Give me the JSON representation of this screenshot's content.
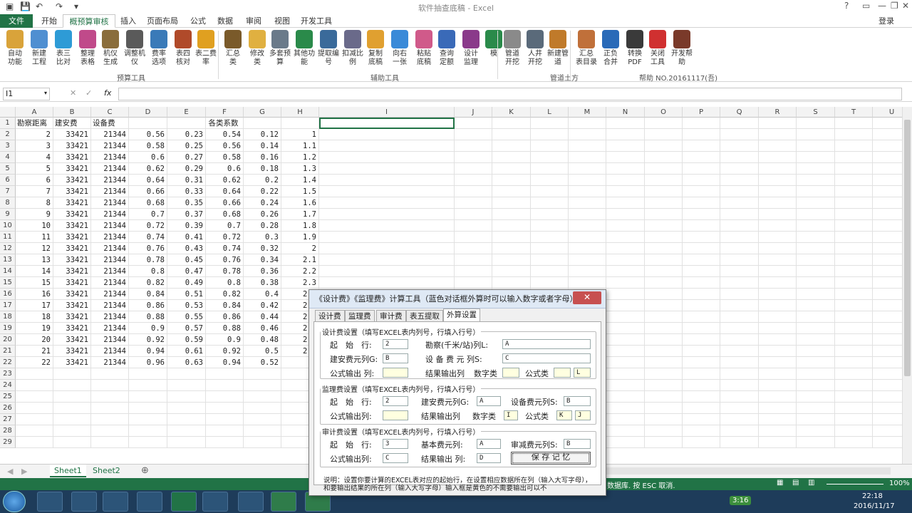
{
  "window": {
    "title": "软件抽查底稿 - Excel",
    "login": "登录"
  },
  "tabs": [
    "文件",
    "开始",
    "概预算审核",
    "插入",
    "页面布局",
    "公式",
    "数据",
    "审阅",
    "视图",
    "开发工具"
  ],
  "ribbon": {
    "buttons": [
      {
        "label": "自动\n功能",
        "icon": "auto-icon"
      },
      {
        "label": "新建\n工程",
        "icon": "new-project-icon"
      },
      {
        "label": "表三\n比对",
        "icon": "compare-icon"
      },
      {
        "label": "整理\n表格",
        "icon": "tidy-icon"
      },
      {
        "label": "机仪\n生成",
        "icon": "machine-icon"
      },
      {
        "label": "调整机\n仪",
        "icon": "adjust-icon"
      },
      {
        "label": "费率\n选项",
        "icon": "rate-icon"
      },
      {
        "label": "表四\n核对",
        "icon": "house-icon"
      },
      {
        "label": "表二费\n率",
        "icon": "pie-icon"
      },
      {
        "label": "汇总\n类",
        "icon": "people-icon"
      },
      {
        "label": "修改\n类",
        "icon": "pencil-icon"
      },
      {
        "label": "多套预\n算",
        "icon": "stack-icon"
      },
      {
        "label": "其他功\n能",
        "icon": "globe-icon"
      },
      {
        "label": "提取编\n号",
        "icon": "extract-icon"
      },
      {
        "label": "扣减比\n例",
        "icon": "deduct-icon"
      },
      {
        "label": "复制\n底稿",
        "icon": "copy-icon"
      },
      {
        "label": "向右\n一张",
        "icon": "arrow-right-icon"
      },
      {
        "label": "粘贴\n底稿",
        "icon": "paste-icon"
      },
      {
        "label": "查询\n定额",
        "icon": "query-icon"
      },
      {
        "label": "设计\n监理",
        "icon": "design-icon"
      },
      {
        "label": "模",
        "icon": "template-icon"
      },
      {
        "label": "管道\n开挖",
        "icon": "pipe-icon"
      },
      {
        "label": "人井\n开挖",
        "icon": "well-icon"
      },
      {
        "label": "新建管\n道",
        "icon": "new-pipe-icon"
      },
      {
        "label": "汇总\n表目录",
        "icon": "summary-icon"
      },
      {
        "label": "正负\n合并",
        "icon": "plus-minus-icon"
      },
      {
        "label": "转换\nPDF",
        "icon": "printer-icon"
      },
      {
        "label": "关闭\n工具",
        "icon": "close-tool-icon"
      },
      {
        "label": "开发帮\n助",
        "icon": "avatar-icon"
      }
    ],
    "groups": [
      "预算工具",
      "辅助工具",
      "管道土方",
      "帮助 NO.20161117(吾)"
    ]
  },
  "formula_bar": {
    "namebox": "I1",
    "formula": ""
  },
  "columns": [
    "A",
    "B",
    "C",
    "D",
    "E",
    "F",
    "G",
    "H",
    "I",
    "J",
    "K",
    "L",
    "M",
    "N",
    "O",
    "P",
    "Q",
    "R",
    "S",
    "T",
    "U"
  ],
  "rows_count": 29,
  "header_row": {
    "A": "勘察距离",
    "B": "建安费",
    "C": "设备费",
    "F": "各类系数"
  },
  "data_rows": [
    [
      "2",
      "33421",
      "21344",
      "0.56",
      "0.23",
      "0.54",
      "0.12",
      "1"
    ],
    [
      "3",
      "33421",
      "21344",
      "0.58",
      "0.25",
      "0.56",
      "0.14",
      "1.1"
    ],
    [
      "4",
      "33421",
      "21344",
      "0.6",
      "0.27",
      "0.58",
      "0.16",
      "1.2"
    ],
    [
      "5",
      "33421",
      "21344",
      "0.62",
      "0.29",
      "0.6",
      "0.18",
      "1.3"
    ],
    [
      "6",
      "33421",
      "21344",
      "0.64",
      "0.31",
      "0.62",
      "0.2",
      "1.4"
    ],
    [
      "7",
      "33421",
      "21344",
      "0.66",
      "0.33",
      "0.64",
      "0.22",
      "1.5"
    ],
    [
      "8",
      "33421",
      "21344",
      "0.68",
      "0.35",
      "0.66",
      "0.24",
      "1.6"
    ],
    [
      "9",
      "33421",
      "21344",
      "0.7",
      "0.37",
      "0.68",
      "0.26",
      "1.7"
    ],
    [
      "10",
      "33421",
      "21344",
      "0.72",
      "0.39",
      "0.7",
      "0.28",
      "1.8"
    ],
    [
      "11",
      "33421",
      "21344",
      "0.74",
      "0.41",
      "0.72",
      "0.3",
      "1.9"
    ],
    [
      "12",
      "33421",
      "21344",
      "0.76",
      "0.43",
      "0.74",
      "0.32",
      "2"
    ],
    [
      "13",
      "33421",
      "21344",
      "0.78",
      "0.45",
      "0.76",
      "0.34",
      "2.1"
    ],
    [
      "14",
      "33421",
      "21344",
      "0.8",
      "0.47",
      "0.78",
      "0.36",
      "2.2"
    ],
    [
      "15",
      "33421",
      "21344",
      "0.82",
      "0.49",
      "0.8",
      "0.38",
      "2.3"
    ],
    [
      "16",
      "33421",
      "21344",
      "0.84",
      "0.51",
      "0.82",
      "0.4",
      "2.4"
    ],
    [
      "17",
      "33421",
      "21344",
      "0.86",
      "0.53",
      "0.84",
      "0.42",
      "2.5"
    ],
    [
      "18",
      "33421",
      "21344",
      "0.88",
      "0.55",
      "0.86",
      "0.44",
      "2.6"
    ],
    [
      "19",
      "33421",
      "21344",
      "0.9",
      "0.57",
      "0.88",
      "0.46",
      "2.7"
    ],
    [
      "20",
      "33421",
      "21344",
      "0.92",
      "0.59",
      "0.9",
      "0.48",
      "2.8"
    ],
    [
      "21",
      "33421",
      "21344",
      "0.94",
      "0.61",
      "0.92",
      "0.5",
      "2.9"
    ],
    [
      "22",
      "33421",
      "21344",
      "0.96",
      "0.63",
      "0.94",
      "0.52",
      "3"
    ]
  ],
  "sheets": [
    "Sheet1",
    "Sheet2"
  ],
  "status": {
    "text": "数据库. 按 ESC 取消.",
    "zoom": "100%"
  },
  "taskbar": {
    "time": "22:18",
    "date": "2016/11/17",
    "badge": "3:16"
  },
  "dialog": {
    "title": "《设计费》《监理费》计算工具（蓝色对话框外算时可以输入数字或者字母）",
    "close": "✕",
    "tabs": [
      "设计费",
      "监理费",
      "审计费",
      "表五提取",
      "外算设置"
    ],
    "design": {
      "legend": "设计费设置（填写EXCEL表内列号，行填入行号）",
      "start_row_label": "起　始　行:",
      "start_row": "2",
      "survey_label": "勘察(千米/站)列L:",
      "survey": "A",
      "build_label": "建安费元列G:",
      "build": "B",
      "equip_label": "设 备 费 元 列S:",
      "equip": "C",
      "formula_label": "公式输出 列:",
      "formula": "",
      "result_label": "结果输出列",
      "num_label": "数字类",
      "num": "",
      "fclass_label": "公式类",
      "fclass1": "",
      "fclass2": "L"
    },
    "supervise": {
      "legend": "监理费设置（填写EXCEL表内列号，行填入行号）",
      "start_row_label": "起　始　行:",
      "start_row": "2",
      "build_label": "建安费元列G:",
      "build": "A",
      "equip_label": "设备费元列S:",
      "equip": "B",
      "formula_label": "公式输出列:",
      "formula": "",
      "result_label": "结果输出列",
      "num_label": "数字类",
      "num": "I",
      "fclass_label": "公式类",
      "fclass1": "K",
      "fclass2": "J"
    },
    "audit": {
      "legend": "审计费设置（填写EXCEL表内列号，行填入行号）",
      "start_row_label": "起　始　行:",
      "start_row": "3",
      "base_label": "基本费元列:",
      "base": "A",
      "reduce_label": "审减费元列S:",
      "reduce": "B",
      "formula_label": "公式输出列:",
      "formula": "C",
      "result_label": "结果输出 列:",
      "result": "D",
      "save": "保 存 记 忆"
    },
    "note": "说明：设置你要计算的EXCEL表对应的起始行，在设置相应数据所在列（输入大写字母），和要输出结果的所在列（输入大写字母）输入框是黄色的不需要输出可以不"
  }
}
